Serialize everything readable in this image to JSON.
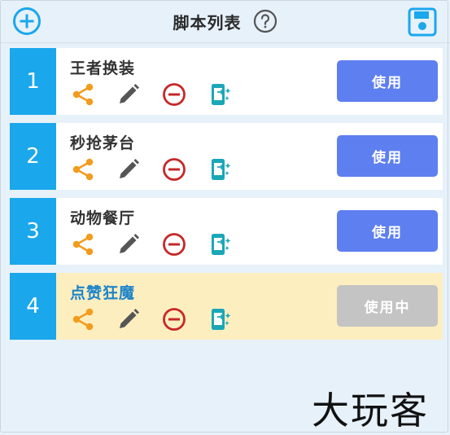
{
  "header": {
    "title": "脚本列表",
    "add_icon": "plus-circle-icon",
    "help_icon": "question-circle-icon",
    "save_icon": "save-icon"
  },
  "scripts": [
    {
      "index": "1",
      "name": "王者换装",
      "button": "使用",
      "active": false
    },
    {
      "index": "2",
      "name": "秒抢茅台",
      "button": "使用",
      "active": false
    },
    {
      "index": "3",
      "name": "动物餐厅",
      "button": "使用",
      "active": false
    },
    {
      "index": "4",
      "name": "点赞狂魔",
      "button": "使用中",
      "active": true
    }
  ],
  "row_icons": [
    "share-icon",
    "edit-pencil-icon",
    "delete-minus-circle-icon",
    "phone-sparkle-icon"
  ],
  "watermark": "大玩客",
  "colors": {
    "accent_blue": "#1aa7ec",
    "button_blue": "#5e7ff0",
    "active_row": "#fdeec0",
    "share_orange": "#f29b1d",
    "delete_red": "#c62828",
    "phone_teal": "#1aa7b8"
  }
}
